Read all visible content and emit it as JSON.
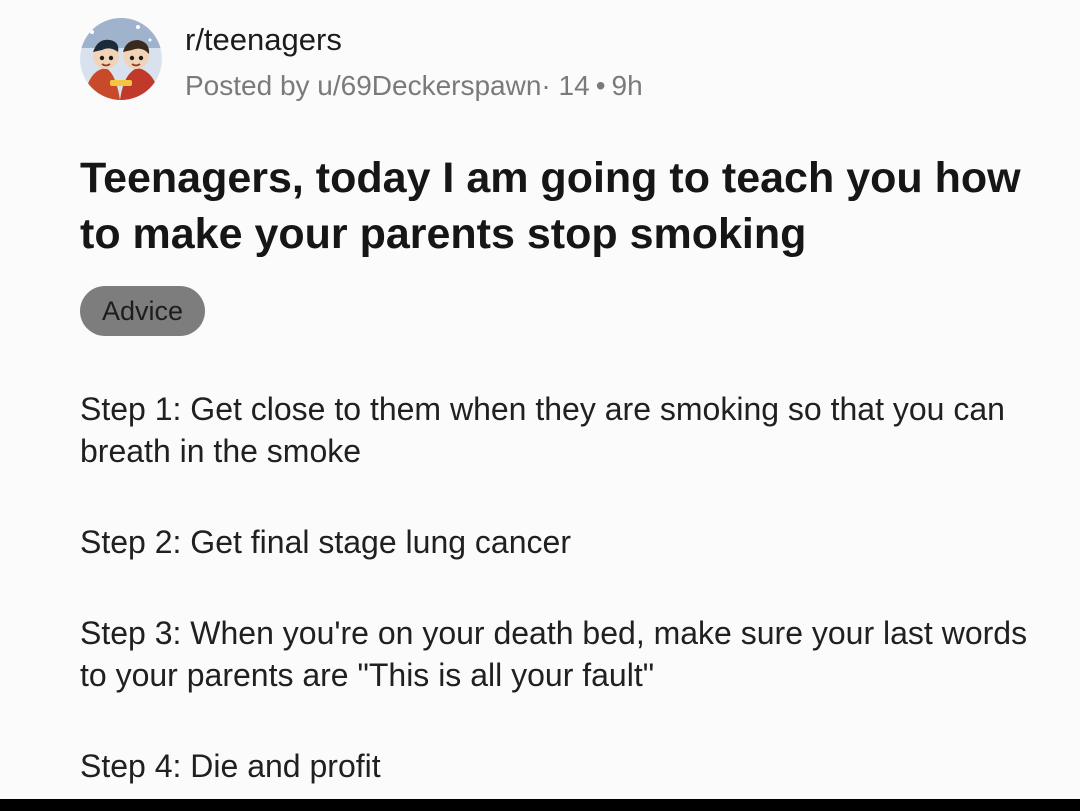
{
  "post": {
    "subreddit": "r/teenagers",
    "posted_by": "Posted by u/69Deckerspawn·",
    "flair_number": "14",
    "age": "9h",
    "title": "Teenagers, today I am going to teach you how to make your parents stop smoking",
    "flair": "Advice",
    "steps": [
      "Step 1: Get close to them when they are smoking so that you can breath in the smoke",
      "Step 2: Get final stage lung cancer",
      "Step 3: When you're on your death bed, make sure your last words to your parents are \"This is all your fault\"",
      "Step 4: Die and profit"
    ]
  },
  "icons": {
    "avatar": "subreddit-avatar-icon"
  },
  "colors": {
    "background": "#fbfbfb",
    "meta_text": "#7a7a7a",
    "flair_bg": "#7d7d7d",
    "bottom_bar": "#000000"
  }
}
